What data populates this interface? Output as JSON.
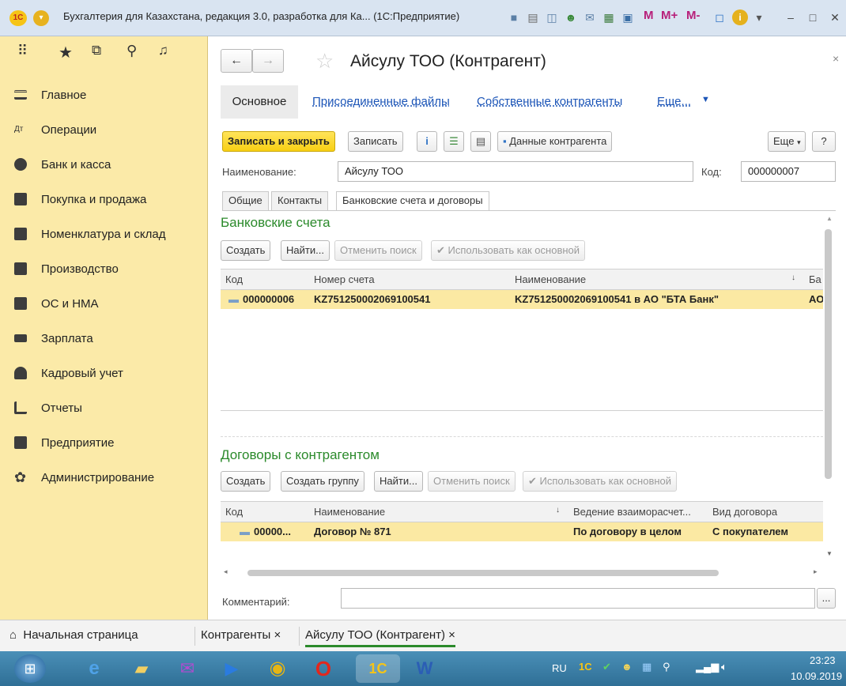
{
  "window": {
    "title": "Бухгалтерия для Казахстана, редакция 3.0, разработка для Ка... (1С:Предприятие)",
    "mm_labels": [
      "M",
      "M+",
      "M-"
    ]
  },
  "sidebar": {
    "items": [
      {
        "label": "Главное",
        "icon": "menu-icon"
      },
      {
        "label": "Операции",
        "icon": "operations-icon"
      },
      {
        "label": "Банк и касса",
        "icon": "bank-icon"
      },
      {
        "label": "Покупка и продажа",
        "icon": "cart-icon"
      },
      {
        "label": "Номенклатура и склад",
        "icon": "warehouse-icon"
      },
      {
        "label": "Производство",
        "icon": "production-icon"
      },
      {
        "label": "ОС и НМА",
        "icon": "assets-icon"
      },
      {
        "label": "Зарплата",
        "icon": "salary-icon"
      },
      {
        "label": "Кадровый учет",
        "icon": "personnel-icon"
      },
      {
        "label": "Отчеты",
        "icon": "reports-icon"
      },
      {
        "label": "Предприятие",
        "icon": "enterprise-icon"
      },
      {
        "label": "Администрирование",
        "icon": "gear-icon"
      }
    ]
  },
  "form": {
    "title": "Айсулу ТОО (Контрагент)",
    "nav": {
      "main": "Основное",
      "attached": "Присоединенные файлы",
      "own": "Собственные контрагенты",
      "more": "Еще..."
    },
    "toolbar": {
      "save_close": "Записать и закрыть",
      "save": "Записать",
      "counterparty_data": "Данные контрагента",
      "more": "Еще",
      "help": "?"
    },
    "name_label": "Наименование:",
    "name_value": "Айсулу ТОО",
    "code_label": "Код:",
    "code_value": "000000007",
    "tabs": [
      "Общие",
      "Контакты",
      "Банковские счета и договоры"
    ],
    "bank": {
      "title": "Банковские счета",
      "buttons": {
        "create": "Создать",
        "find": "Найти...",
        "cancel_search": "Отменить поиск",
        "use_main": "Использовать как основной"
      },
      "columns": [
        "Код",
        "Номер счета",
        "Наименование",
        "Ба"
      ],
      "rows": [
        {
          "code": "000000006",
          "number": "KZ751250002069100541",
          "name": "KZ751250002069100541 в АО \"БТА Банк\"",
          "bank": "АО"
        }
      ]
    },
    "contracts": {
      "title": "Договоры с контрагентом",
      "buttons": {
        "create": "Создать",
        "create_group": "Создать группу",
        "find": "Найти...",
        "cancel_search": "Отменить поиск",
        "use_main": "Использовать как основной"
      },
      "columns": [
        "Код",
        "Наименование",
        "Ведение взаиморасчет...",
        "Вид договора"
      ],
      "rows": [
        {
          "code": "00000...",
          "name": "Договор № 871",
          "settlement": "По договору в целом",
          "type": "С покупателем"
        }
      ]
    },
    "comment_label": "Комментарий:",
    "comment_button": "..."
  },
  "bottom_tabs": {
    "home": "Начальная страница",
    "counterparties": "Контрагенты ×",
    "current": "Айсулу ТОО (Контрагент) ×"
  },
  "taskbar": {
    "lang": "RU",
    "time": "23:23",
    "date": "10.09.2019"
  }
}
